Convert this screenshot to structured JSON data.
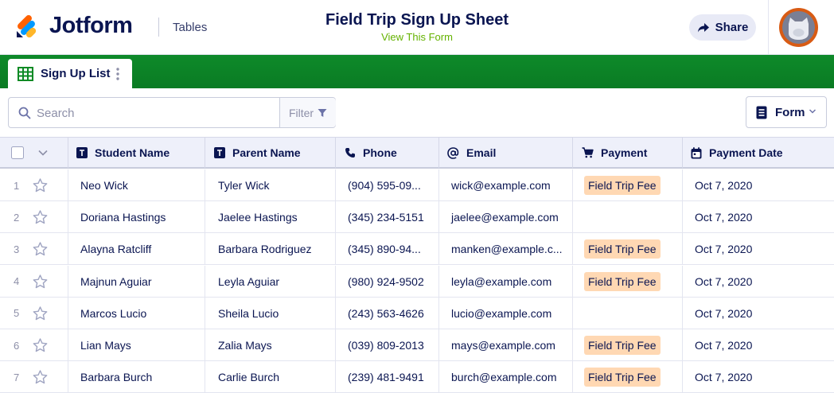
{
  "header": {
    "brand": "Jotform",
    "tables_link": "Tables",
    "title": "Field Trip Sign Up Sheet",
    "view_form": "View This Form",
    "share_label": "Share"
  },
  "tab": {
    "label": "Sign Up List"
  },
  "toolbar": {
    "search_placeholder": "Search",
    "filter_label": "Filter",
    "form_label": "Form"
  },
  "columns": [
    {
      "label": "Student Name",
      "icon": "text-icon"
    },
    {
      "label": "Parent Name",
      "icon": "text-icon"
    },
    {
      "label": "Phone",
      "icon": "phone-icon"
    },
    {
      "label": "Email",
      "icon": "at-icon"
    },
    {
      "label": "Payment",
      "icon": "cart-icon"
    },
    {
      "label": "Payment Date",
      "icon": "calendar-icon"
    }
  ],
  "rows": [
    {
      "num": "1",
      "student": "Neo Wick",
      "parent": "Tyler Wick",
      "phone": "(904) 595-09...",
      "email": "wick@example.com",
      "payment": "Field Trip Fee",
      "date": "Oct 7, 2020"
    },
    {
      "num": "2",
      "student": "Doriana Hastings",
      "parent": "Jaelee Hastings",
      "phone": "(345) 234-5151",
      "email": "jaelee@example.com",
      "payment": "",
      "date": "Oct 7, 2020"
    },
    {
      "num": "3",
      "student": "Alayna Ratcliff",
      "parent": "Barbara Rodriguez",
      "phone": "(345) 890-94...",
      "email": "manken@example.c...",
      "payment": "Field Trip Fee",
      "date": "Oct 7, 2020"
    },
    {
      "num": "4",
      "student": "Majnun Aguiar",
      "parent": "Leyla Aguiar",
      "phone": "(980) 924-9502",
      "email": "leyla@example.com",
      "payment": "Field Trip Fee",
      "date": "Oct 7, 2020"
    },
    {
      "num": "5",
      "student": "Marcos Lucio",
      "parent": "Sheila Lucio",
      "phone": "(243) 563-4626",
      "email": "lucio@example.com",
      "payment": "",
      "date": "Oct 7, 2020"
    },
    {
      "num": "6",
      "student": "Lian Mays",
      "parent": "Zalia Mays",
      "phone": "(039) 809-2013",
      "email": "mays@example.com",
      "payment": "Field Trip Fee",
      "date": "Oct 7, 2020"
    },
    {
      "num": "7",
      "student": "Barbara Burch",
      "parent": "Carlie Burch",
      "phone": "(239) 481-9491",
      "email": "burch@example.com",
      "payment": "Field Trip Fee",
      "date": "Oct 7, 2020"
    }
  ],
  "colors": {
    "accent_green": "#0a7b23",
    "brand_navy": "#0a1551",
    "badge": "#ffd8b3",
    "link_green": "#64b200"
  }
}
